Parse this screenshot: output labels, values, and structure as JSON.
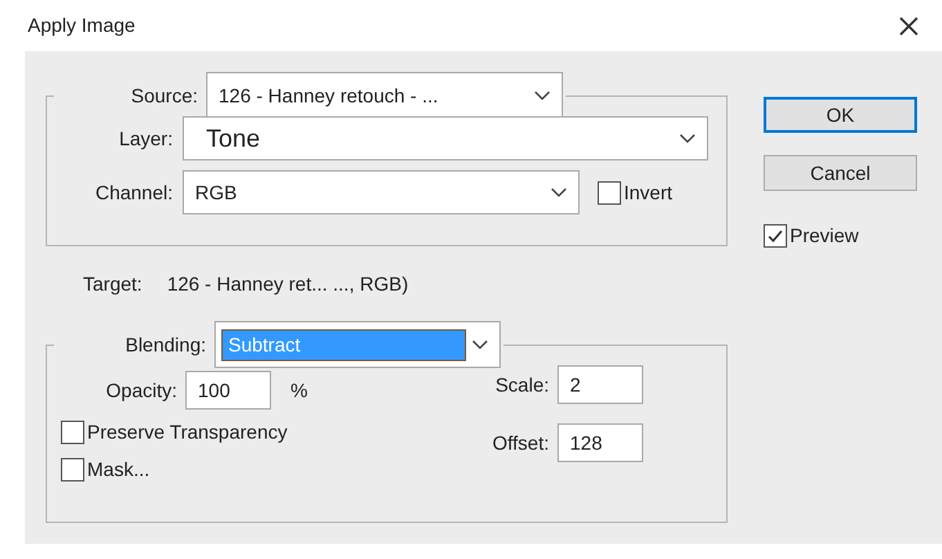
{
  "window": {
    "title": "Apply Image"
  },
  "source": {
    "label": "Source:",
    "value": "126 - Hanney retouch - ..."
  },
  "layer": {
    "label": "Layer:",
    "value": "Tone"
  },
  "channel": {
    "label": "Channel:",
    "value": "RGB"
  },
  "invert": {
    "label": "Invert",
    "checked": false
  },
  "target": {
    "label": "Target:",
    "value": "126 - Hanney ret... ..., RGB)"
  },
  "blending": {
    "label": "Blending:",
    "value": "Subtract"
  },
  "opacity": {
    "label": "Opacity:",
    "value": "100",
    "unit": "%"
  },
  "scale": {
    "label": "Scale:",
    "value": "2"
  },
  "offset": {
    "label": "Offset:",
    "value": "128"
  },
  "preserve_transparency": {
    "label": "Preserve Transparency",
    "checked": false
  },
  "mask": {
    "label": "Mask...",
    "checked": false
  },
  "buttons": [
    {
      "label": "OK",
      "default": true
    },
    {
      "label": "Cancel",
      "default": false
    }
  ],
  "preview": {
    "label": "Preview",
    "checked": true
  }
}
